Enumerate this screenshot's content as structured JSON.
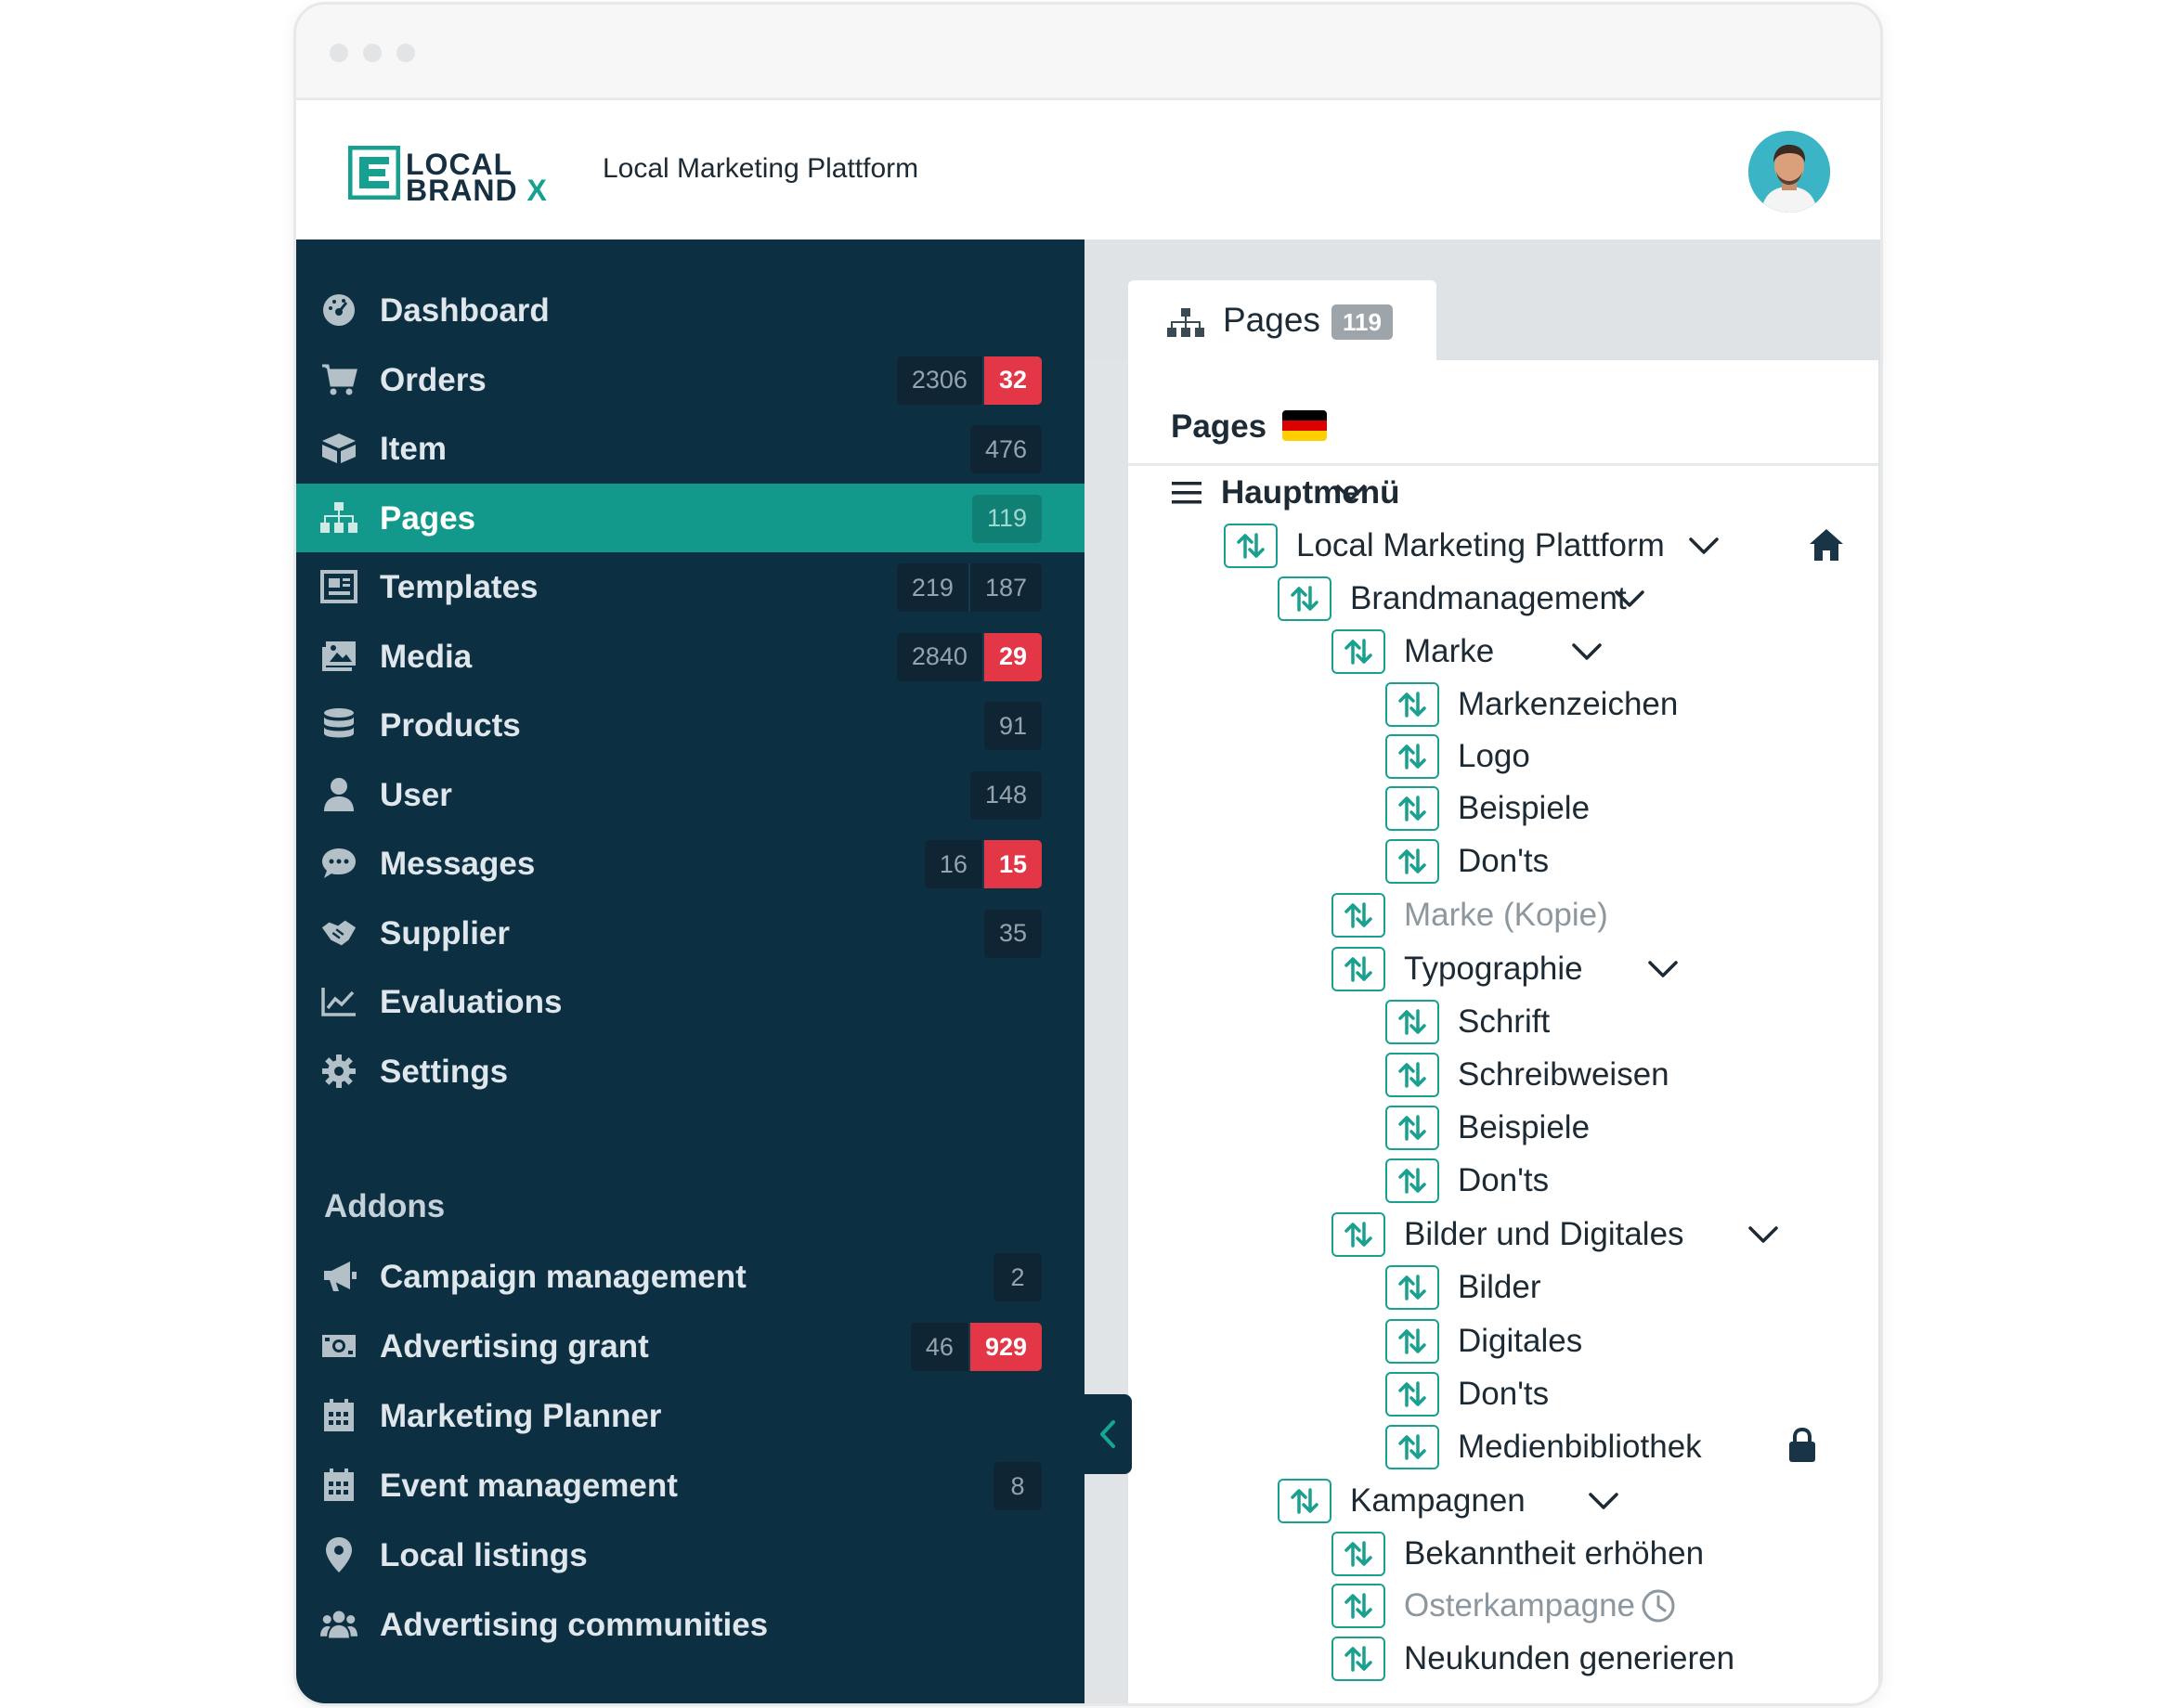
{
  "header": {
    "logo_line1": "LOCAL",
    "logo_line2": "BRAND",
    "logo_x": "X",
    "app_title": "Local Marketing Plattform"
  },
  "sidebar": {
    "items": [
      {
        "label": "Dashboard",
        "icon": "dashboard-icon",
        "badges": []
      },
      {
        "label": "Orders",
        "icon": "cart-icon",
        "badges": [
          "2306",
          "32"
        ]
      },
      {
        "label": "Item",
        "icon": "box-icon",
        "badges": [
          "476"
        ]
      },
      {
        "label": "Pages",
        "icon": "sitemap-icon",
        "badges": [
          "119"
        ],
        "active": true
      },
      {
        "label": "Templates",
        "icon": "template-icon",
        "badges": [
          "219",
          "187"
        ]
      },
      {
        "label": "Media",
        "icon": "image-icon",
        "badges": [
          "2840",
          "29"
        ]
      },
      {
        "label": "Products",
        "icon": "database-icon",
        "badges": [
          "91"
        ]
      },
      {
        "label": "User",
        "icon": "user-icon",
        "badges": [
          "148"
        ]
      },
      {
        "label": "Messages",
        "icon": "chat-icon",
        "badges": [
          "16",
          "15"
        ]
      },
      {
        "label": "Supplier",
        "icon": "handshake-icon",
        "badges": [
          "35"
        ]
      },
      {
        "label": "Evaluations",
        "icon": "chart-line-icon",
        "badges": []
      },
      {
        "label": "Settings",
        "icon": "gear-icon",
        "badges": []
      }
    ],
    "addons_label": "Addons",
    "addons": [
      {
        "label": "Campaign management",
        "icon": "megaphone-icon",
        "badges": [
          "2"
        ]
      },
      {
        "label": "Advertising grant",
        "icon": "money-icon",
        "badges": [
          "46",
          "929"
        ]
      },
      {
        "label": "Marketing Planner",
        "icon": "calendar-icon",
        "badges": []
      },
      {
        "label": "Event management",
        "icon": "calendar-icon",
        "badges": [
          "8"
        ]
      },
      {
        "label": "Local listings",
        "icon": "map-pin-icon",
        "badges": []
      },
      {
        "label": "Advertising communities",
        "icon": "users-icon",
        "badges": []
      }
    ]
  },
  "tab": {
    "label": "Pages",
    "count": "119"
  },
  "panel": {
    "title": "Pages"
  },
  "tree": {
    "root": "Hauptmenü",
    "nodes": [
      {
        "label": "Local Marketing Plattform"
      },
      {
        "label": "Brandmanagement"
      },
      {
        "label": "Marke"
      },
      {
        "label": "Markenzeichen"
      },
      {
        "label": "Logo"
      },
      {
        "label": "Beispiele"
      },
      {
        "label": "Don'ts"
      },
      {
        "label": "Marke (Kopie)"
      },
      {
        "label": "Typographie"
      },
      {
        "label": "Schrift"
      },
      {
        "label": "Schreibweisen"
      },
      {
        "label": "Beispiele"
      },
      {
        "label": "Don'ts"
      },
      {
        "label": "Bilder und Digitales"
      },
      {
        "label": "Bilder"
      },
      {
        "label": "Digitales"
      },
      {
        "label": "Don'ts"
      },
      {
        "label": "Medienbibliothek"
      },
      {
        "label": "Kampagnen"
      },
      {
        "label": "Bekanntheit erhöhen"
      },
      {
        "label": "Osterkampagne"
      },
      {
        "label": "Neukunden generieren"
      }
    ]
  },
  "colors": {
    "sidebar_bg": "#0c2f42",
    "accent": "#12998b",
    "badge_red": "#e33647"
  }
}
